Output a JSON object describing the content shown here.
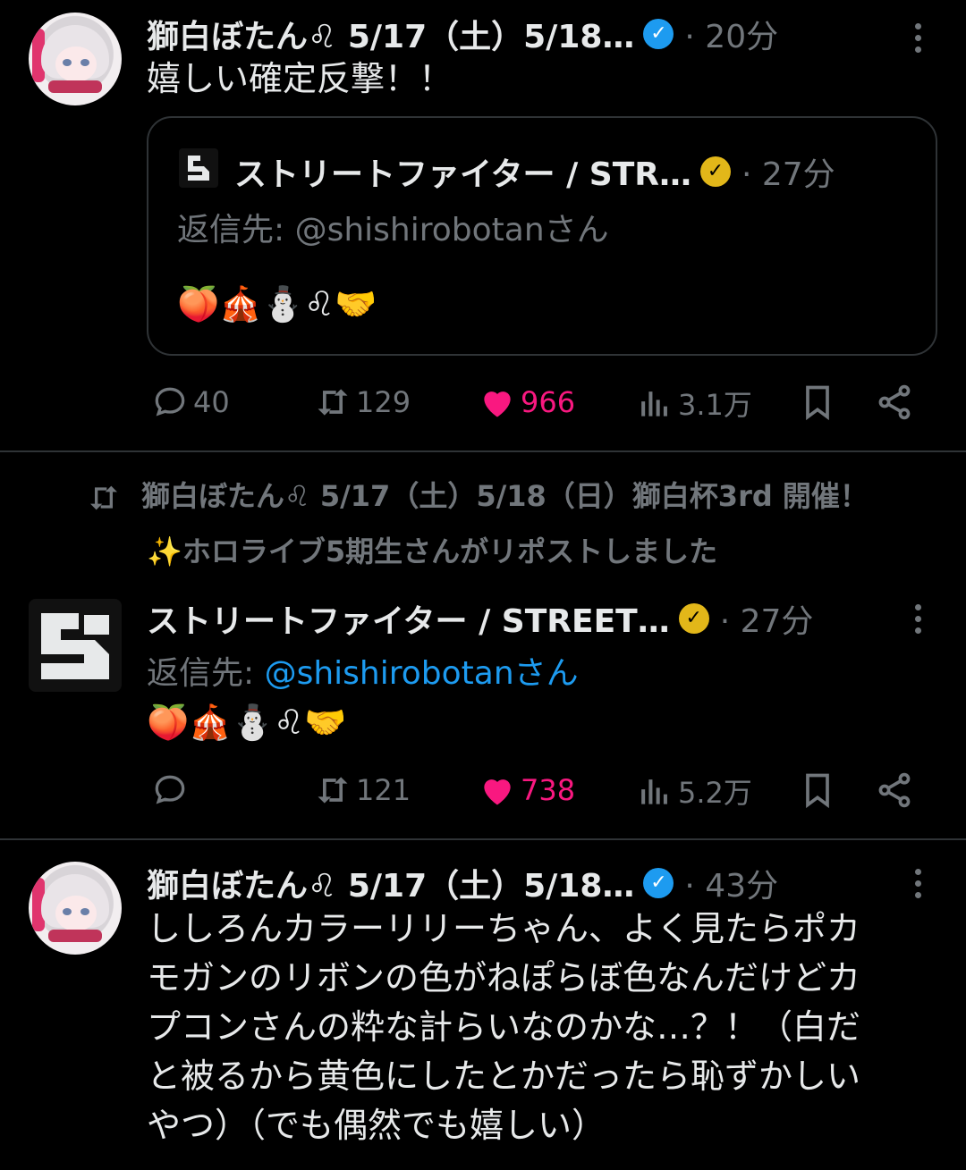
{
  "tweet1": {
    "author": "獅白ぼたん",
    "author_suffix": "♌ 5/17（土）5/18…",
    "time": "· 20分",
    "text": "嬉しい確定反撃！！",
    "quote": {
      "author": "ストリートファイター / STR…",
      "time": "· 27分",
      "reply_prefix": "返信先: ",
      "reply_handle": "@shishirobotanさん",
      "emojis": "🍑🎪⛄♌🤝"
    },
    "stats": {
      "replies": "40",
      "reposts": "129",
      "likes": "966",
      "views": "3.1万"
    }
  },
  "repost_banner": {
    "line1": "獅白ぼたん♌ 5/17（土）5/18（日）獅白杯3rd 開催！",
    "line2": "✨ホロライブ5期生さんがリポストしました"
  },
  "tweet2": {
    "author": "ストリートファイター / STREET…",
    "time": "· 27分",
    "reply_prefix": "返信先: ",
    "reply_handle": "@shishirobotanさん",
    "emojis": "🍑🎪⛄♌🤝",
    "stats": {
      "replies": "",
      "reposts": "121",
      "likes": "738",
      "views": "5.2万"
    }
  },
  "tweet3": {
    "author": "獅白ぼたん",
    "author_suffix": "♌ 5/17（土）5/18…",
    "time": "· 43分",
    "text": "ししろんカラーリリーちゃん、よく見たらポカ\nモガンのリボンの色がねぽらぼ色なんだけどカ\nプコンさんの粋な計らいなのかな…？！（白だ\nと被るから黄色にしたとかだったら恥ずかしい\nやつ）（でも偶然でも嬉しい）"
  },
  "colors": {
    "accent": "#1d9bf0",
    "like": "#f91880",
    "muted": "#71767b",
    "gold_badge": "#e2b719"
  },
  "icons": [
    "reply-icon",
    "repost-icon",
    "like-icon",
    "views-icon",
    "bookmark-icon",
    "share-icon",
    "more-icon",
    "verified-icon"
  ]
}
